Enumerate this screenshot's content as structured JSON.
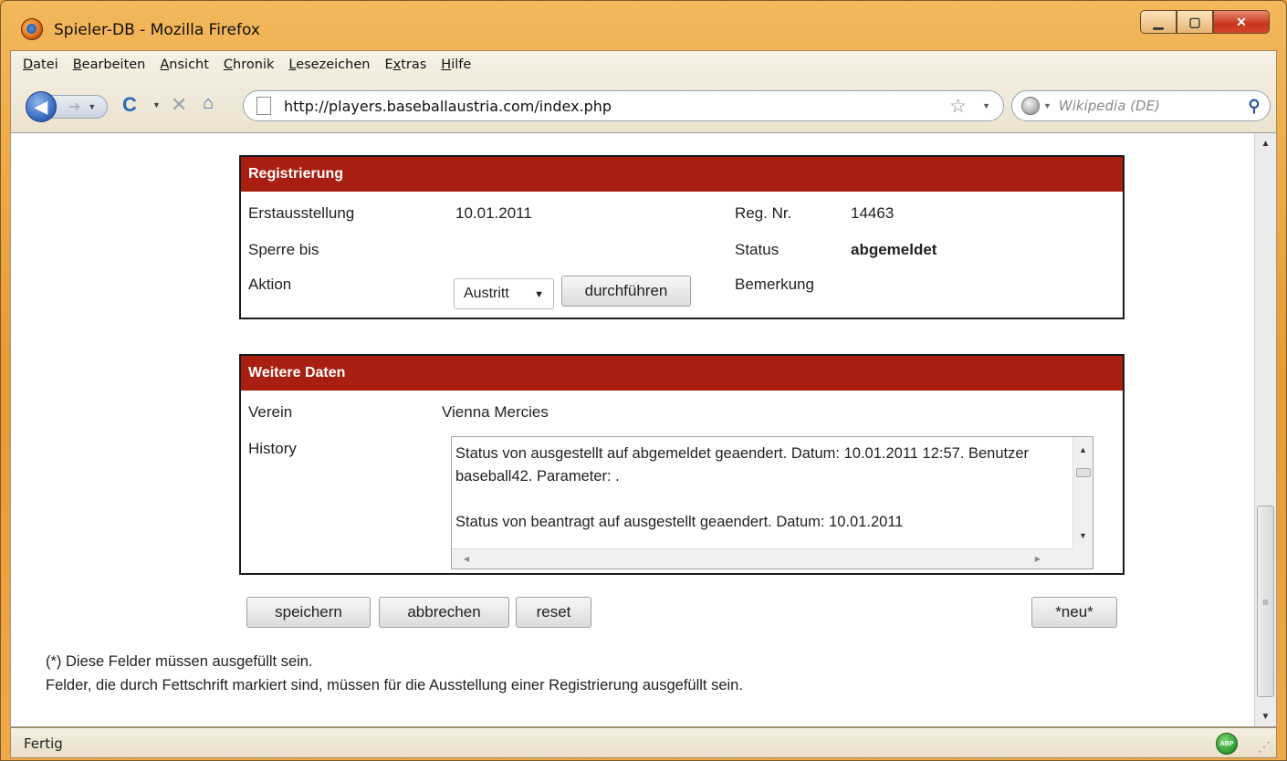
{
  "window": {
    "title": "Spieler-DB - Mozilla Firefox",
    "controls": {
      "minimize": "▁",
      "maximize": "▢",
      "close": "✕"
    }
  },
  "menu": {
    "items": [
      {
        "label": "Datei",
        "access": "D"
      },
      {
        "label": "Bearbeiten",
        "access": "B"
      },
      {
        "label": "Ansicht",
        "access": "A"
      },
      {
        "label": "Chronik",
        "access": "C"
      },
      {
        "label": "Lesezeichen",
        "access": "L"
      },
      {
        "label": "Extras",
        "access": "x"
      },
      {
        "label": "Hilfe",
        "access": "H"
      }
    ]
  },
  "nav": {
    "back_icon": "arrow-left-icon",
    "forward_icon": "arrow-right-icon",
    "url": "http://players.baseballaustria.com/index.php",
    "search_placeholder": "Wikipedia (DE)"
  },
  "registrierung": {
    "header": "Registrierung",
    "erstausstellung_label": "Erstausstellung",
    "erstausstellung_value": "10.01.2011",
    "regnr_label": "Reg. Nr.",
    "regnr_value": "14463",
    "sperre_label": "Sperre bis",
    "status_label": "Status",
    "status_value": "abgemeldet",
    "aktion_label": "Aktion",
    "aktion_selected": "Austritt",
    "durchfuehren_label": "durchführen",
    "bemerkung_label": "Bemerkung"
  },
  "weitere": {
    "header": "Weitere Daten",
    "verein_label": "Verein",
    "verein_value": "Vienna Mercies",
    "history_label": "History",
    "history_lines": [
      "Status von ausgestellt auf abgemeldet geaendert. Datum: 10.01.2011 12:57. Benutzer baseball42. Parameter: .",
      "Status von beantragt auf ausgestellt geaendert. Datum: 10.01.2011"
    ]
  },
  "buttons": {
    "speichern": "speichern",
    "abbrechen": "abbrechen",
    "reset": "reset",
    "neu": "*neu*"
  },
  "notes": {
    "required": "(*) Diese Felder müssen ausgefüllt sein.",
    "bold_fields": "Felder, die durch Fettschrift markiert sind, müssen für die Ausstellung einer Registrierung ausgefüllt sein."
  },
  "status_bar": {
    "text": "Fertig",
    "abp_label": "ABP"
  },
  "colors": {
    "panel_header": "#a81e10",
    "window_frame": "#f0a040"
  }
}
